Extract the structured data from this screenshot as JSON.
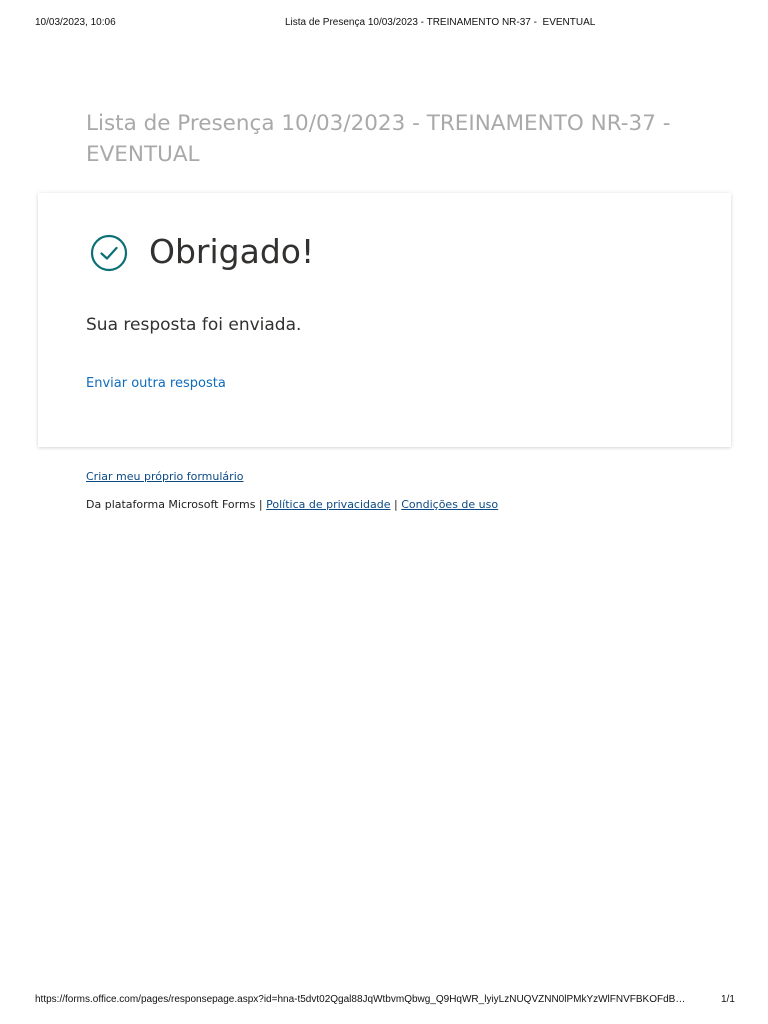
{
  "print_header": {
    "datetime": "10/03/2023, 10:06",
    "doc_title": "Lista de Presença 10/03/2023 - TREINAMENTO NR-37 -  EVENTUAL"
  },
  "form": {
    "title": "Lista de Presença 10/03/2023 - TREINAMENTO NR-37 - EVENTUAL"
  },
  "confirmation": {
    "icon": "check-circle-icon",
    "heading": "Obrigado!",
    "message": "Sua resposta foi enviada.",
    "another_response_link": "Enviar outra resposta"
  },
  "footer": {
    "create_link": "Criar meu próprio formulário",
    "platform_text": "Da plataforma Microsoft Forms",
    "separator": "|",
    "privacy_link": "Política de privacidade",
    "terms_link": "Condições de uso"
  },
  "print_footer": {
    "url": "https://forms.office.com/pages/responsepage.aspx?id=hna-t5dvt02Qgal88JqWtbvmQbwg_Q9HqWR_lyiyLzNUQVZNN0lPMkYzWlFNVFBKOFdB…",
    "page_number": "1/1"
  },
  "colors": {
    "accent_teal": "#0b7076",
    "link_blue": "#0f6cbd",
    "title_gray": "#a9a9a9"
  }
}
